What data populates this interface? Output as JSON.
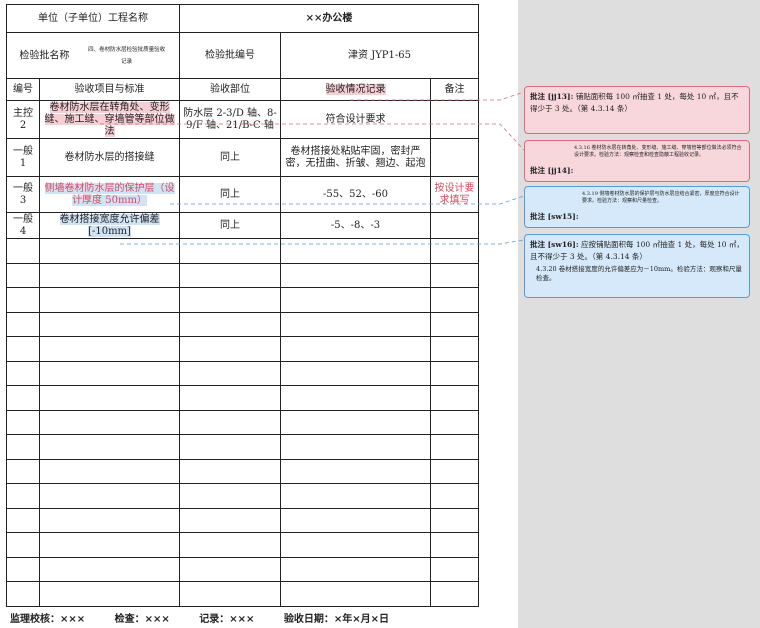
{
  "header": {
    "unit_label": "单位（子单位）工程名称",
    "unit_value": "××办公楼",
    "batch_name_label": "检验批名称",
    "batch_name_value": "四、卷材防水层检验批质量验收记录",
    "batch_no_label": "检验批编号",
    "batch_no_value": "津资 JYP1-65"
  },
  "columns": {
    "no": "编号",
    "item": "验收项目与标准",
    "location": "验收部位",
    "record": "验收情况记录",
    "note": "备注"
  },
  "rows": [
    {
      "no": "主控\n2",
      "item": "卷材防水层在转角处、变形缝、施工缝、穿墙管等部位做法",
      "location": "防水层 2-3/D 轴、8-9/F 轴、21/B-C 轴",
      "record": "符合设计要求",
      "note": ""
    },
    {
      "no": "一般\n1",
      "item": "卷材防水层的搭接缝",
      "location": "同上",
      "record": "卷材搭接处粘贴牢固，密封严密，无扭曲、折皱、翘边、起泡",
      "note": ""
    },
    {
      "no": "一般\n3",
      "item": "侧墙卷材防水层的保护层（设计厚度 50mm）",
      "location": "同上",
      "record": "-55、52、-60",
      "note": "按设计要求填写"
    },
    {
      "no": "一般\n4",
      "item": "卷材搭接宽度允许偏差[-10mm]",
      "location": "同上",
      "record": "-5、-8、-3",
      "note": ""
    }
  ],
  "footer": {
    "supervisor": "监理校核：×××",
    "checker": "检查：×××",
    "recorder": "记录：×××",
    "date": "验收日期：×年×月×日"
  },
  "comments": [
    {
      "tag": "批注 [jj13]:",
      "text": "铺贴面积每 100 ㎡抽查 1 处，每处 10 ㎡，且不得少于 3 处。（第 4.3.14 条）",
      "color": "#f8d7dc"
    },
    {
      "tag": "批注 [jj14]:",
      "quote": "4.3.16 卷材防水层在转角处、变形缝、施工缝、穿墙管等部位做法必须符合设计要求。检验方法：观察检查和检查隐蔽工程验收记录。",
      "color": "#f8d7dc"
    },
    {
      "tag": "批注 [sw15]:",
      "quote": "4.3.19 侧墙卷材防水层的保护层与防水层应结合紧密，厚度应符合设计要求。检验方法：观察和尺量检查。",
      "color": "#d6e9fa"
    },
    {
      "tag": "批注 [sw16]:",
      "text": "应按铺贴面积每 100 ㎡抽查 1 处，每处 10 ㎡，且不得少于 3 处。（第 4.3.14 条）",
      "quote": "4.3.20 卷材搭接宽度的允许偏差应为－10mm。检验方法：观察和尺量检查。",
      "color": "#d6e9fa"
    }
  ]
}
